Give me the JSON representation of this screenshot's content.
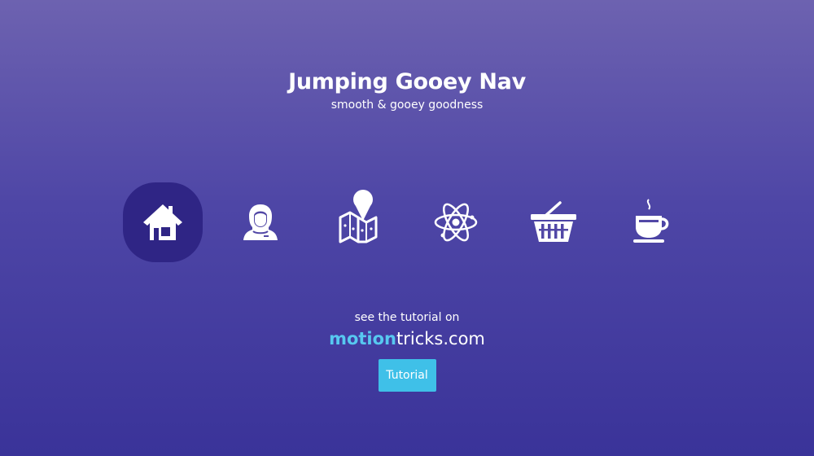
{
  "header": {
    "title": "Jumping Gooey Nav",
    "subtitle": "smooth & gooey goodness"
  },
  "nav": {
    "items": [
      {
        "icon": "home-icon",
        "active": true
      },
      {
        "icon": "user-icon",
        "active": false
      },
      {
        "icon": "map-icon",
        "active": false
      },
      {
        "icon": "atom-icon",
        "active": false
      },
      {
        "icon": "basket-icon",
        "active": false
      },
      {
        "icon": "coffee-icon",
        "active": false
      }
    ]
  },
  "footer": {
    "see_text": "see the tutorial on",
    "site_brand": "motion",
    "site_rest": "tricks.com",
    "button_label": "Tutorial"
  },
  "colors": {
    "background_top": "#6d62b0",
    "background_bottom": "#3a3399",
    "active_blob": "#2f2585",
    "brand_accent": "#57c8f0",
    "button": "#3fc0e8"
  }
}
